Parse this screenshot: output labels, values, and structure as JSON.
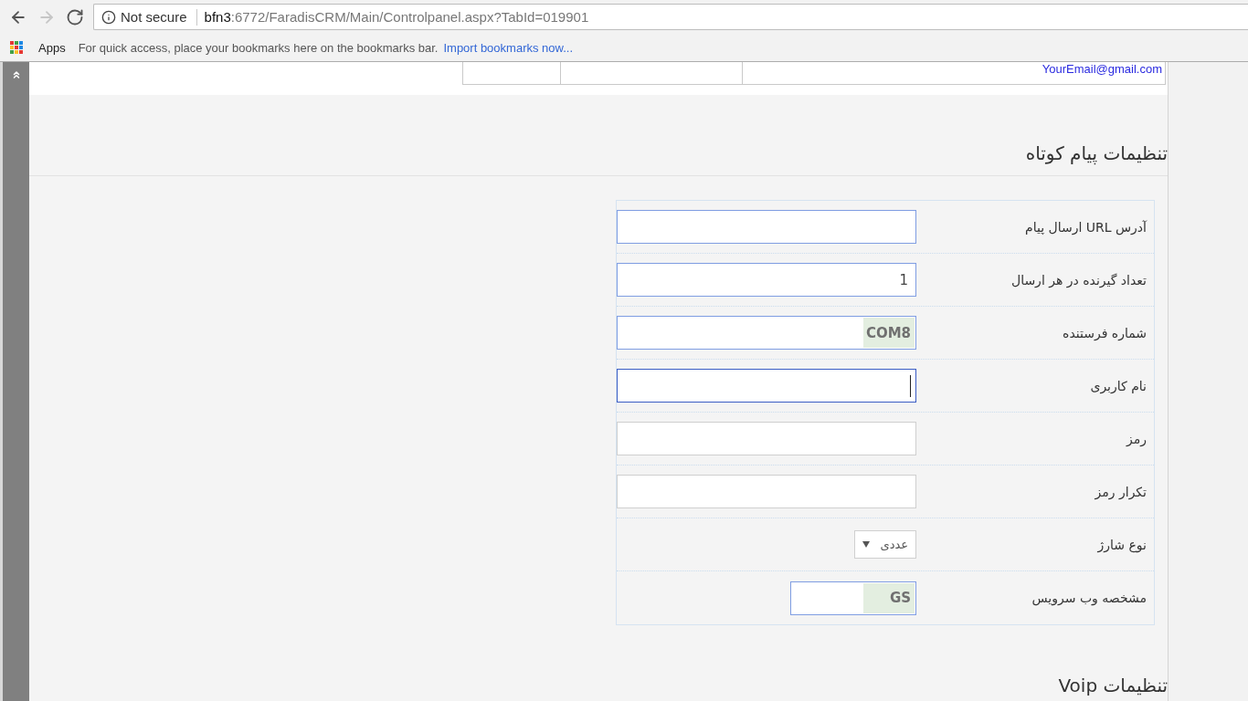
{
  "browser": {
    "nav_buttons": [
      {
        "kind": "back",
        "disabled": false
      },
      {
        "kind": "forward",
        "disabled": true
      },
      {
        "kind": "reload",
        "disabled": false
      }
    ],
    "security_label": "Not secure",
    "url_host": "bfn3",
    "url_path": ":6772/FaradisCRM/Main/Controlpanel.aspx?TabId=019901"
  },
  "bookmarks_bar": {
    "apps_label": "Apps",
    "hint": "For quick access, place your bookmarks here on the bookmarks bar.",
    "import_link": "Import bookmarks now..."
  },
  "top_table_row": {
    "email": "YourEmail@gmail.com"
  },
  "sms_settings": {
    "title": "تنظیمات پیام کوتاه",
    "fields": [
      {
        "label": "آدرس URL ارسال پیام",
        "kind": "input",
        "highlighted": true,
        "focused": false
      },
      {
        "label": "تعداد گیرنده در هر ارسال",
        "kind": "input",
        "value": "1",
        "value_shaded": false,
        "highlighted": true,
        "focused": false
      },
      {
        "label": "شماره فرستنده",
        "kind": "input",
        "value": "COM8",
        "value_shaded": true,
        "highlighted": true,
        "focused": false
      },
      {
        "label": "نام کاربری",
        "kind": "input",
        "highlighted": true,
        "focused": true
      },
      {
        "label": "رمز",
        "kind": "input",
        "highlighted": false,
        "focused": false
      },
      {
        "label": "تکرار رمز",
        "kind": "input",
        "highlighted": false,
        "focused": false
      },
      {
        "label": "نوع شارژ",
        "kind": "select",
        "value": "عددی",
        "value_shaded": false,
        "highlighted": false,
        "focused": false
      },
      {
        "label": "مشخصه وب سرویس",
        "kind": "short-input",
        "value": "GS",
        "value_shaded": true,
        "highlighted": true,
        "focused": false
      }
    ]
  },
  "voip_settings": {
    "title": "تنظیمات Voip"
  }
}
